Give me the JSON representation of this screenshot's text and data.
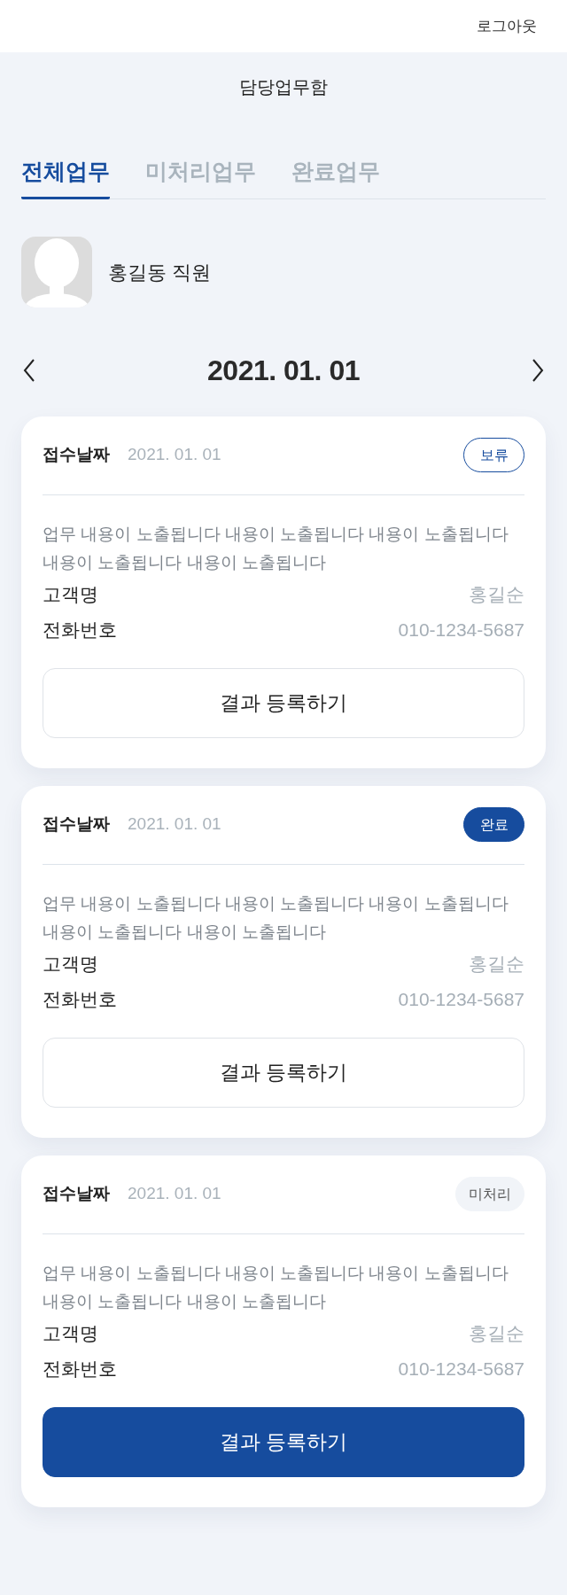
{
  "header": {
    "logout": "로그아웃"
  },
  "page_title": "담당업무함",
  "tabs": [
    {
      "label": "전체업무",
      "selected": true
    },
    {
      "label": "미처리업무",
      "selected": false
    },
    {
      "label": "완료업무",
      "selected": false
    }
  ],
  "profile": {
    "name": "홍길동 직원"
  },
  "date_nav": {
    "date": "2021. 01. 01"
  },
  "tasks": [
    {
      "date_label": "접수날짜",
      "date": "2021. 01. 01",
      "status": {
        "label": "보류",
        "kind": "outline"
      },
      "description": "업무 내용이 노출됩니다 내용이 노출됩니다 내용이 노출됩니다 내용이 노출됩니다 내용이 노출됩니다",
      "fields": [
        {
          "label": "고객명",
          "value": "홍길순"
        },
        {
          "label": "전화번호",
          "value": "010-1234-5687"
        }
      ],
      "button": {
        "label": "결과 등록하기",
        "kind": "outline"
      }
    },
    {
      "date_label": "접수날짜",
      "date": "2021. 01. 01",
      "status": {
        "label": "완료",
        "kind": "filled"
      },
      "description": "업무 내용이 노출됩니다 내용이 노출됩니다 내용이 노출됩니다 내용이 노출됩니다 내용이 노출됩니다",
      "fields": [
        {
          "label": "고객명",
          "value": "홍길순"
        },
        {
          "label": "전화번호",
          "value": "010-1234-5687"
        }
      ],
      "button": {
        "label": "결과 등록하기",
        "kind": "outline"
      }
    },
    {
      "date_label": "접수날짜",
      "date": "2021. 01. 01",
      "status": {
        "label": "미처리",
        "kind": "muted"
      },
      "description": "업무 내용이 노출됩니다 내용이 노출됩니다 내용이 노출됩니다 내용이 노출됩니다 내용이 노출됩니다",
      "fields": [
        {
          "label": "고객명",
          "value": "홍길순"
        },
        {
          "label": "전화번호",
          "value": "010-1234-5687"
        }
      ],
      "button": {
        "label": "결과 등록하기",
        "kind": "primary"
      }
    }
  ]
}
